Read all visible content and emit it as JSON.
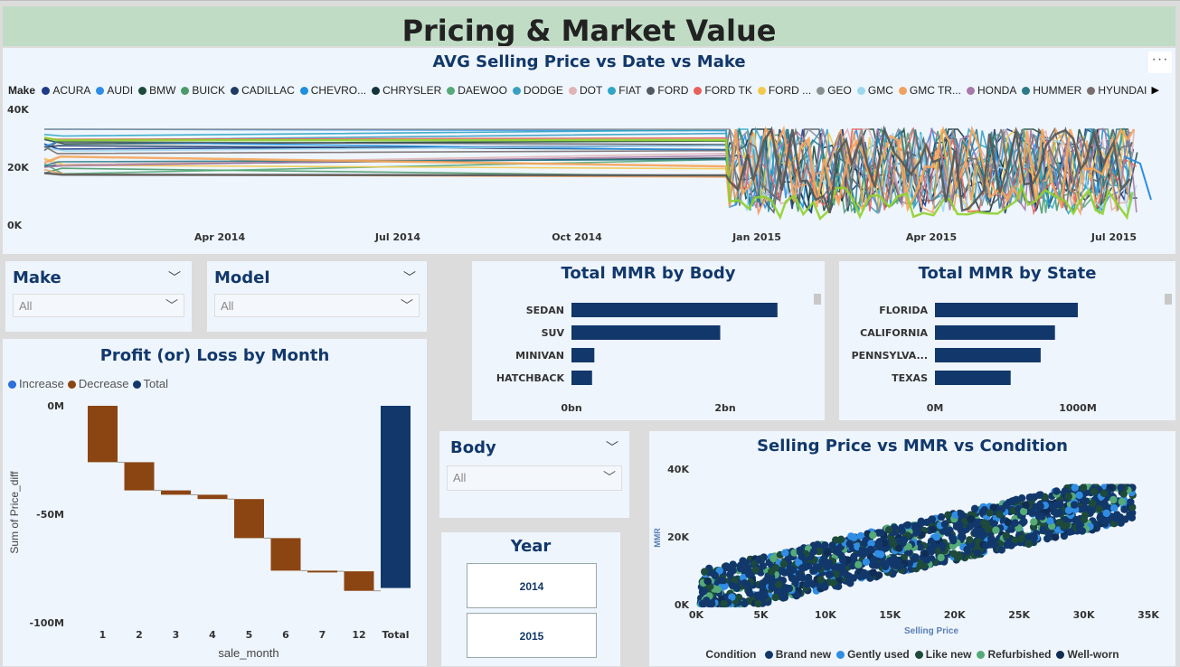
{
  "page_title": "Pricing & Market Value",
  "colors": {
    "title_bg": "#c0dcc5",
    "title_text": "#12386b",
    "panel_bg": "#eef5fd",
    "bar_navy": "#12386b",
    "decrease": "#8b4513",
    "increase": "#2a6fdb"
  },
  "line_chart": {
    "title": "AVG Selling Price vs Date vs Make",
    "more_icon": "ellipsis-icon",
    "legend_label": "Make",
    "legend_items": [
      {
        "name": "ACURA",
        "color": "#1e3a8a"
      },
      {
        "name": "AUDI",
        "color": "#2f8de4"
      },
      {
        "name": "BMW",
        "color": "#1d4a3a"
      },
      {
        "name": "BUICK",
        "color": "#4c9a6a"
      },
      {
        "name": "CADILLAC",
        "color": "#1f3c66"
      },
      {
        "name": "CHEVRO...",
        "color": "#1f8fe0"
      },
      {
        "name": "CHRYSLER",
        "color": "#15333a"
      },
      {
        "name": "DAEWOO",
        "color": "#55aa77"
      },
      {
        "name": "DODGE",
        "color": "#3aa0c2"
      },
      {
        "name": "DOT",
        "color": "#e0b4b4"
      },
      {
        "name": "FIAT",
        "color": "#2fa6c6"
      },
      {
        "name": "FORD",
        "color": "#555a60"
      },
      {
        "name": "FORD TK",
        "color": "#e8605a"
      },
      {
        "name": "FORD ...",
        "color": "#f2c94c"
      },
      {
        "name": "GEO",
        "color": "#8a9090"
      },
      {
        "name": "GMC",
        "color": "#9ed8f0"
      },
      {
        "name": "GMC TR...",
        "color": "#f0a060"
      },
      {
        "name": "HONDA",
        "color": "#a87aa8"
      },
      {
        "name": "HUMMER",
        "color": "#2b7a8a"
      },
      {
        "name": "HYUNDAI",
        "color": "#7a6e6e"
      }
    ],
    "legend_next_icon": "triangle-right-icon",
    "y_ticks": [
      "40K",
      "20K",
      "0K"
    ],
    "x_ticks": [
      "Apr 2014",
      "Jul 2014",
      "Oct 2014",
      "Jan 2015",
      "Apr 2015",
      "Jul 2015"
    ]
  },
  "slicers": {
    "make": {
      "title": "Make",
      "value": "All"
    },
    "model": {
      "title": "Model",
      "value": "All"
    },
    "body": {
      "title": "Body",
      "value": "All"
    }
  },
  "mmr_by_body": {
    "title": "Total MMR by Body",
    "chart_data": {
      "type": "bar",
      "orientation": "horizontal",
      "categories": [
        "SEDAN",
        "SUV",
        "MINIVAN",
        "HATCHBACK"
      ],
      "values": [
        2.7,
        1.95,
        0.3,
        0.27
      ],
      "unit": "bn",
      "xlim": [
        0,
        3.2
      ],
      "x_ticks": [
        "0bn",
        "2bn"
      ]
    }
  },
  "mmr_by_state": {
    "title": "Total MMR by State",
    "chart_data": {
      "type": "bar",
      "orientation": "horizontal",
      "categories": [
        "FLORIDA",
        "CALIFORNIA",
        "PENNSYLVA...",
        "TEXAS"
      ],
      "values": [
        1000,
        840,
        740,
        530
      ],
      "unit": "M",
      "xlim": [
        0,
        1500
      ],
      "x_ticks": [
        "0M",
        "1000M"
      ]
    }
  },
  "waterfall": {
    "title": "Profit (or) Loss by Month",
    "legend": [
      {
        "name": "Increase",
        "color": "#2a6fdb"
      },
      {
        "name": "Decrease",
        "color": "#8b4513"
      },
      {
        "name": "Total",
        "color": "#12386b"
      }
    ],
    "chart_data": {
      "type": "waterfall",
      "categories": [
        "1",
        "2",
        "3",
        "4",
        "5",
        "6",
        "7",
        "12",
        "Total"
      ],
      "deltas": [
        -26,
        -13,
        -2,
        -2,
        -18,
        -15,
        -0.3,
        -9,
        null
      ],
      "total": -84,
      "ylim": [
        -100,
        0
      ],
      "y_ticks": [
        "0M",
        "-50M",
        "-100M"
      ],
      "ylabel": "Sum of Price_diff",
      "xlabel": "sale_month"
    }
  },
  "year_slicer": {
    "title": "Year",
    "options": [
      "2014",
      "2015"
    ]
  },
  "scatter": {
    "title": "Selling Price vs MMR vs Condition",
    "chart_data": {
      "type": "scatter",
      "xlabel": "Selling Price",
      "ylabel": "MMR",
      "xlim": [
        0,
        35000
      ],
      "ylim": [
        0,
        40000
      ],
      "x_ticks": [
        "0K",
        "5K",
        "10K",
        "15K",
        "20K",
        "25K",
        "30K",
        "35K"
      ],
      "y_ticks": [
        "40K",
        "20K",
        "0K"
      ],
      "legend_label": "Condition",
      "series": [
        {
          "name": "Brand new",
          "color": "#12386b"
        },
        {
          "name": "Gently used",
          "color": "#2f8de4"
        },
        {
          "name": "Like new",
          "color": "#1d4a3a"
        },
        {
          "name": "Refurbished",
          "color": "#55aa77"
        },
        {
          "name": "Well-worn",
          "color": "#0f2d55"
        }
      ]
    }
  }
}
